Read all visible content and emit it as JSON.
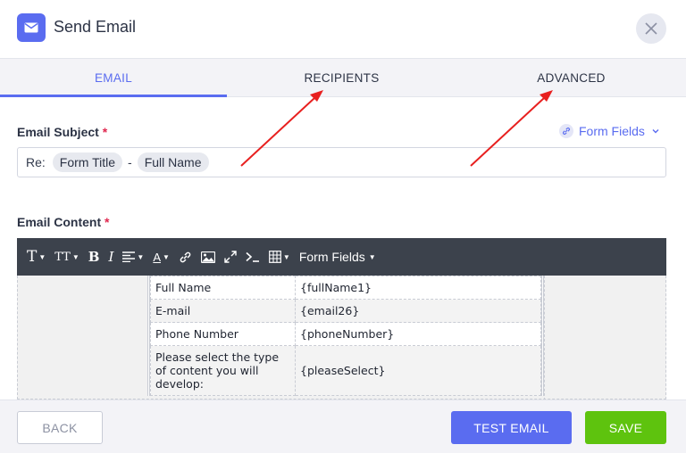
{
  "header": {
    "title": "Send Email",
    "icon": "envelope-icon",
    "close_icon": "close-icon",
    "accent": "#5a6cf0"
  },
  "tabs": [
    {
      "label": "EMAIL",
      "active": true
    },
    {
      "label": "RECIPIENTS",
      "active": false
    },
    {
      "label": "ADVANCED",
      "active": false
    }
  ],
  "subject": {
    "label": "Email Subject",
    "required_mark": "*",
    "prefix": "Re:",
    "chips": [
      "Form Title",
      "Full Name"
    ],
    "separator": "-"
  },
  "form_fields_link": {
    "label": "Form Fields",
    "icon": "link-icon"
  },
  "content": {
    "label": "Email Content",
    "required_mark": "*"
  },
  "toolbar": {
    "items": [
      "text-format-icon",
      "font-size-icon",
      "bold-icon",
      "italic-icon",
      "align-icon",
      "text-color-icon",
      "link-icon",
      "image-icon",
      "fullscreen-icon",
      "code-icon",
      "table-icon"
    ],
    "text_size_glyph": "T",
    "font_size_glyph": "TT",
    "bold_glyph": "B",
    "italic_glyph": "I",
    "color_glyph": "A",
    "form_fields_label": "Form Fields",
    "background": "#3c424c"
  },
  "email_table": [
    {
      "field": "Full Name",
      "value": "{fullName1}"
    },
    {
      "field": "E-mail",
      "value": "{email26}"
    },
    {
      "field": "Phone Number",
      "value": "{phoneNumber}"
    },
    {
      "field": "Please select the type of content you will develop:",
      "value": "{pleaseSelect}"
    }
  ],
  "footer": {
    "back_label": "BACK",
    "test_label": "TEST EMAIL",
    "save_label": "SAVE",
    "test_color": "#5a6cf0",
    "save_color": "#5ec30e"
  },
  "annotations": {
    "arrow_color": "#e8201f"
  }
}
